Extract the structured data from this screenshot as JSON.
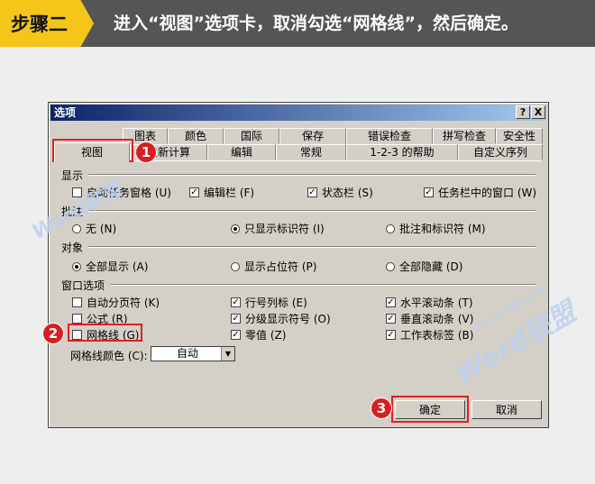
{
  "banner": {
    "step": "步骤二",
    "instruction": "进入“视图”选项卡，取消勾选“网格线”，然后确定。"
  },
  "dialog": {
    "title": "选项",
    "help_btn": "?",
    "close_btn": "X",
    "tabs_back": [
      "图表",
      "颜色",
      "国际",
      "保存",
      "错误检查",
      "拼写检查",
      "安全性"
    ],
    "tabs_front": [
      "视图",
      "重新计算",
      "编辑",
      "常规",
      "1-2-3 的帮助",
      "自定义序列"
    ],
    "sections": {
      "display": "显示",
      "comments": "批注",
      "objects": "对象",
      "window": "窗口选项"
    },
    "display_opts": [
      "启动任务窗格 (U)",
      "编辑栏 (F)",
      "状态栏 (S)",
      "任务栏中的窗口 (W)"
    ],
    "comment_opts": [
      "无 (N)",
      "只显示标识符 (I)",
      "批注和标识符 (M)"
    ],
    "object_opts": [
      "全部显示 (A)",
      "显示占位符 (P)",
      "全部隐藏 (D)"
    ],
    "window_opts": {
      "page_breaks": "自动分页符 (K)",
      "formulas": "公式 (R)",
      "gridlines": "网格线 (G)",
      "row_col_headers": "行号列标 (E)",
      "outline": "分级显示符号 (O)",
      "zero_values": "零值 (Z)",
      "h_scroll": "水平滚动条 (T)",
      "v_scroll": "垂直滚动条 (V)",
      "sheet_tabs": "工作表标签 (B)"
    },
    "grid_color_label": "网格线颜色 (C):",
    "grid_color_value": "自动",
    "ok": "确定",
    "cancel": "取消"
  },
  "callouts": [
    "1",
    "2",
    "3"
  ],
  "watermark": {
    "brand": "Word联盟",
    "site": "www.wordlm.com"
  }
}
